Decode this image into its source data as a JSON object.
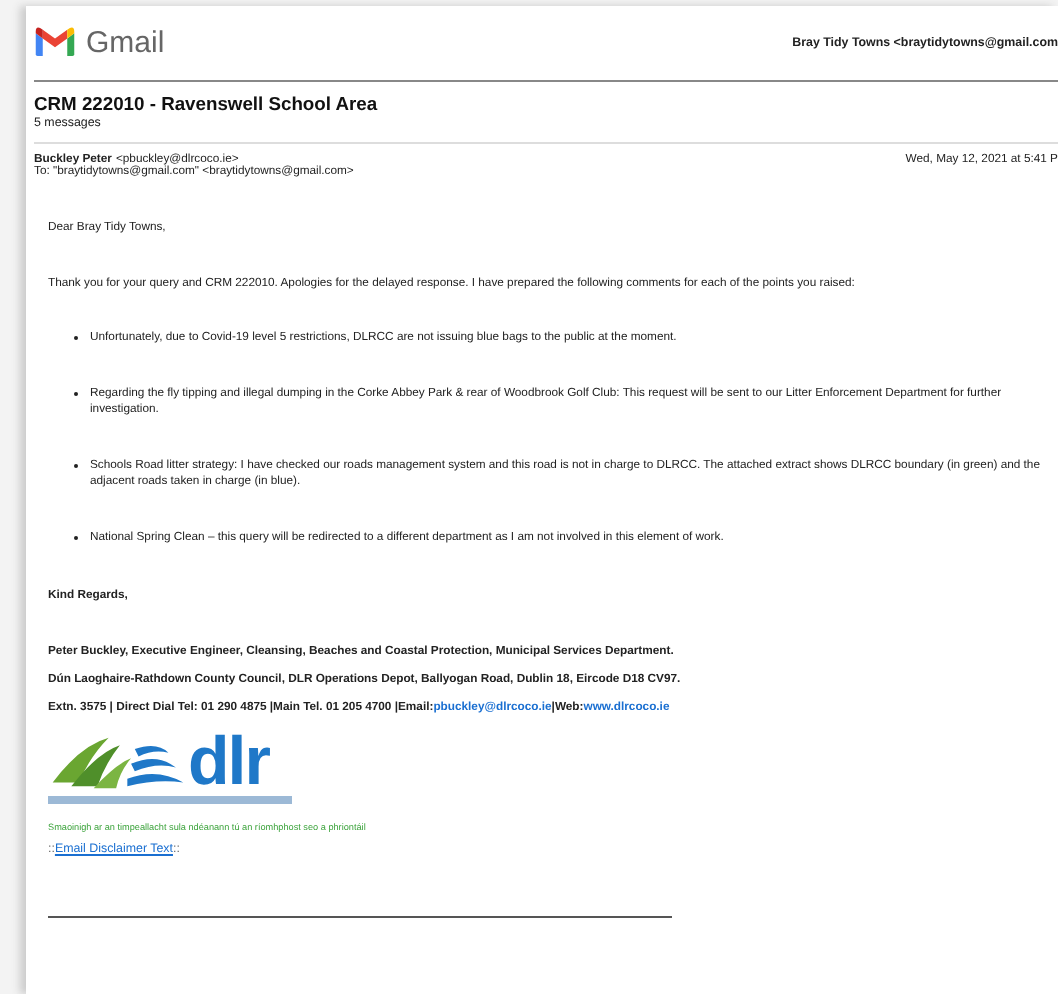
{
  "header": {
    "brand": "Gmail",
    "account": "Bray Tidy Towns <braytidytowns@gmail.com"
  },
  "thread": {
    "title": "CRM 222010 - Ravenswell School Area",
    "count": "5 messages"
  },
  "message": {
    "sender_name": "Buckley Peter",
    "sender_email": "<pbuckley@dlrcoco.ie>",
    "to": "To: \"braytidytowns@gmail.com\" <braytidytowns@gmail.com>",
    "date": "Wed, May 12, 2021 at 5:41 P",
    "body": [
      {
        "kind": "para",
        "text": "Dear Bray Tidy Towns,"
      },
      {
        "kind": "para",
        "text": "Thank you for your query and CRM 222010. Apologies for the delayed response.  I have prepared the following comments for each of the points you raised:"
      },
      {
        "kind": "bullet",
        "text": "Unfortunately, due to Covid-19 level 5 restrictions, DLRCC are not issuing blue bags to the public at the moment."
      },
      {
        "kind": "bullet",
        "text": "Regarding the fly tipping and illegal dumping in the Corke Abbey Park & rear of Woodbrook Golf Club: This request will be sent to our Litter Enforcement Department for further investigation."
      },
      {
        "kind": "bullet",
        "text": "Schools Road litter strategy: I have checked our roads management system and this road is not in charge to DLRCC. The attached extract shows DLRCC boundary (in green) and the adjacent roads taken in charge (in blue)."
      },
      {
        "kind": "bullet",
        "text": "National Spring Clean – this query will be redirected to a different department as I am not involved in this element of work."
      },
      {
        "kind": "closing",
        "text": "Kind Regards,"
      }
    ],
    "signature": [
      "Peter Buckley, Executive Engineer, Cleansing, Beaches and Coastal Protection, Municipal Services Department.",
      "Dún Laoghaire-Rathdown County Council, DLR Operations Depot, Ballyogan Road, Dublin 18, Eircode D18 CV97."
    ],
    "contact": {
      "text": "Extn. 3575 | Direct Dial Tel: 01 290 4875 |Main Tel. 01 205 4700 |Email:",
      "email": "pbuckley@dlrcoco.ie",
      "web_label": "|Web:",
      "web": "www.dlrcoco.ie"
    },
    "logo": {
      "text": "dlr"
    },
    "eco_note": "Smaoinigh ar an timpeallacht sula ndéanann tú an ríomhphost seo a phriontáil",
    "disclaimer": {
      "prefix": "::",
      "link": "Email Disclaimer Text",
      "suffix": "::"
    }
  }
}
